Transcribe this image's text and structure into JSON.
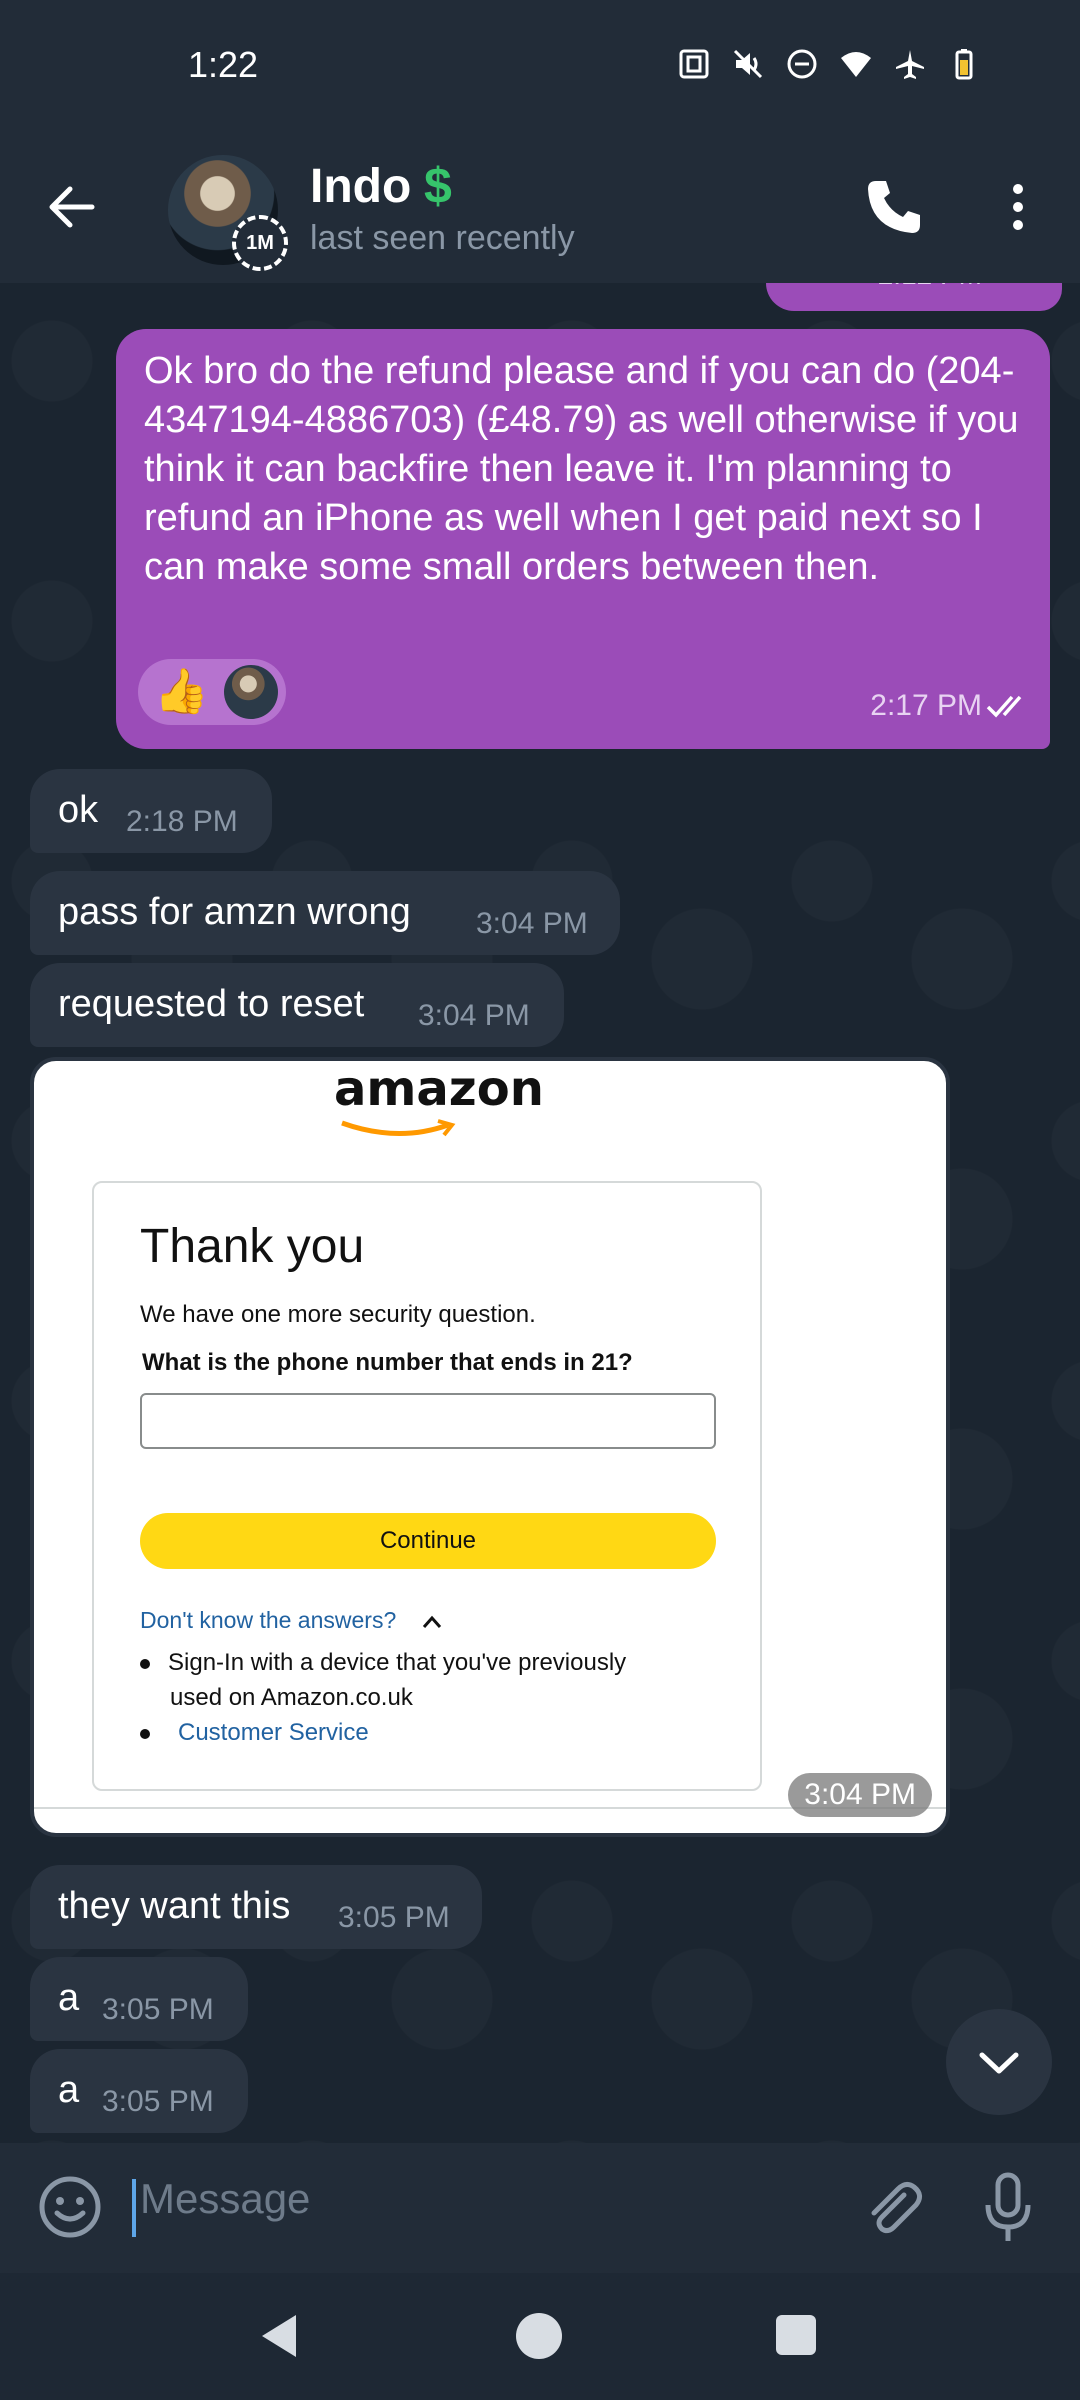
{
  "status_bar": {
    "time": "1:22",
    "icons": [
      "nfc-icon",
      "mute-icon",
      "dnd-icon",
      "wifi-icon",
      "airplane-icon",
      "battery-icon"
    ]
  },
  "header": {
    "contact_name": "Indo",
    "name_emoji": "$",
    "status": "last seen recently",
    "avatar_badge": "1M"
  },
  "messages": {
    "top_partial_time": "2:12 PM",
    "outgoing_main": {
      "text": "Ok bro do the refund please and if you can do (204-4347194-4886703) (£48.79) as well otherwise if you think it can backfire then leave it. I'm planning to refund an iPhone as well when I get paid next so I can make some small orders between then.",
      "time": "2:17 PM",
      "reaction": "👍"
    },
    "incoming": [
      {
        "text": "ok",
        "time": "2:18 PM"
      },
      {
        "text": "pass for amzn wrong",
        "time": "3:04 PM"
      },
      {
        "text": "requested to reset",
        "time": "3:04 PM"
      },
      {
        "text": "they want this",
        "time": "3:05 PM"
      },
      {
        "text": "a",
        "time": "3:05 PM"
      },
      {
        "text": "a",
        "time": "3:05 PM"
      }
    ],
    "image_message": {
      "time": "3:04 PM",
      "amazon": {
        "logo": "amazon",
        "title": "Thank you",
        "subtitle": "We have one more security question.",
        "question": "What is the phone number that ends in 21?",
        "button": "Continue",
        "help_link": "Don't know the answers?",
        "option1_line1": "Sign-In with a device that you've previously",
        "option1_line2": "used on Amazon.co.uk",
        "option2": "Customer Service"
      }
    }
  },
  "composer": {
    "placeholder": "Message"
  },
  "colors": {
    "outgoing_bubble": "#9b4cb8",
    "incoming_bubble": "#2a3441",
    "header_bg": "#222c38",
    "amazon_button": "#ffd814",
    "amazon_link": "#2162a1"
  }
}
